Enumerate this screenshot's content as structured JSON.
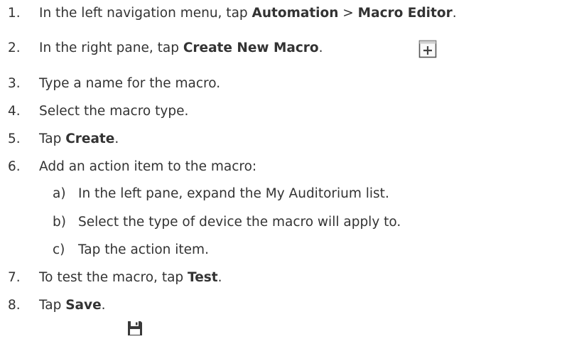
{
  "steps": [
    {
      "num": "1.",
      "pre": "In the left navigation menu, tap ",
      "b1": "Automation",
      "mid": " > ",
      "b2": "Macro Editor",
      "post": "."
    },
    {
      "num": "2.",
      "pre": "In the right pane, tap ",
      "b1": "Create New Macro",
      "post": ".",
      "icon": "add-square-icon"
    },
    {
      "num": "3.",
      "text": "Type a name for the macro."
    },
    {
      "num": "4.",
      "text": "Select the macro type."
    },
    {
      "num": "5.",
      "pre": "Tap ",
      "b1": "Create",
      "post": "."
    },
    {
      "num": "6.",
      "text": "Add an action item to the macro:"
    },
    {
      "num": "7.",
      "pre": "To test the macro, tap ",
      "b1": "Test",
      "post": "."
    },
    {
      "num": "8.",
      "pre": "Tap ",
      "b1": "Save",
      "post": ".",
      "icon": "save-disk-icon"
    }
  ],
  "substeps": [
    {
      "num": "a)",
      "text": "In the left pane, expand the My Auditorium list."
    },
    {
      "num": "b)",
      "text": "Select the type of device the macro will apply to."
    },
    {
      "num": "c)",
      "text": "Tap the action item."
    }
  ]
}
